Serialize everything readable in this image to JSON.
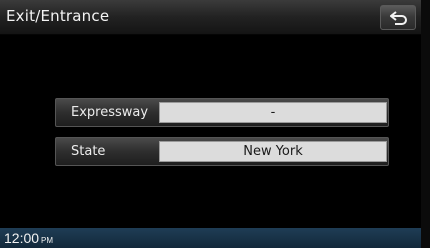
{
  "header": {
    "title": "Exit/Entrance",
    "back_icon": "back-arrow-icon"
  },
  "fields": [
    {
      "label": "Expressway",
      "value": "-"
    },
    {
      "label": "State",
      "value": "New York"
    }
  ],
  "status": {
    "time": "12:00",
    "ampm": "PM"
  }
}
